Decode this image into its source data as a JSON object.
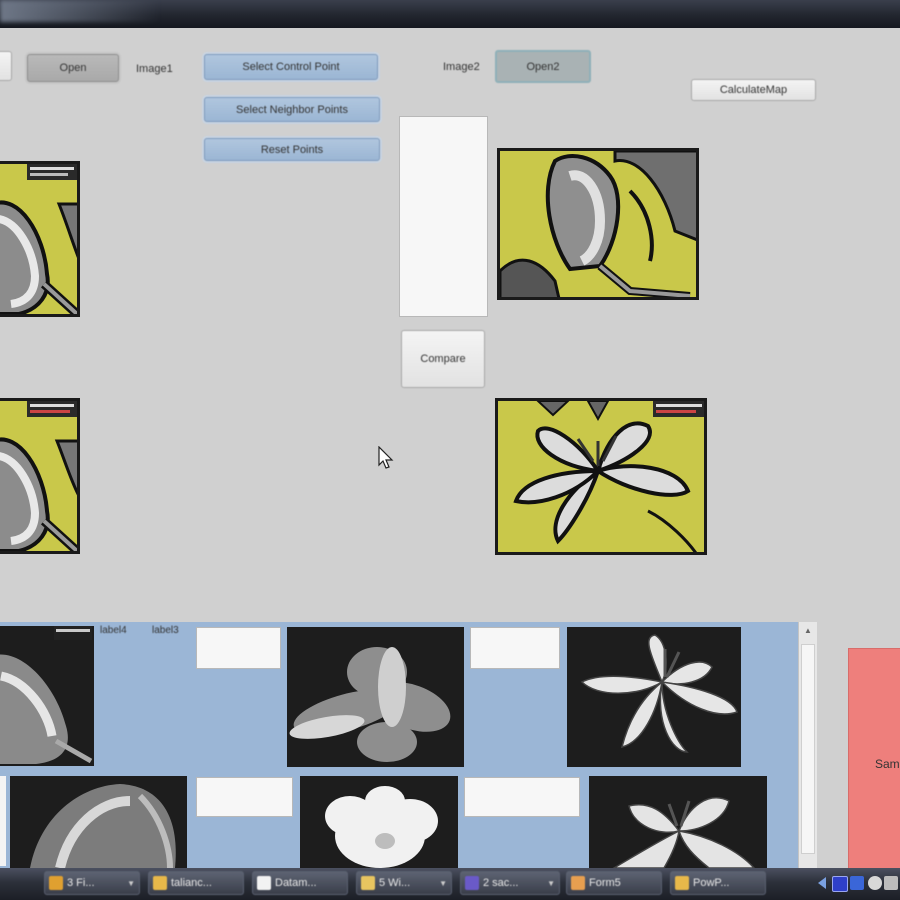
{
  "toolbar": {
    "open_label": "Open",
    "image1_label": "Image1",
    "select_control_label": "Select Control Point",
    "select_neighbor_label": "Select Neighbor Points",
    "reset_points_label": "Reset Points",
    "image2_label": "Image2",
    "open2_label": "Open2",
    "calculate_map_label": "CalculateMap"
  },
  "middle": {
    "compare_label": "Compare"
  },
  "gallery": {
    "label_a": "label4",
    "label_b": "label3"
  },
  "side_panel": {
    "label": "Sam"
  },
  "taskbar": {
    "items": [
      {
        "label": "3 Fi...",
        "icon": "folder-icon",
        "color": "#e0a030"
      },
      {
        "label": "talianc...",
        "icon": "folder-icon",
        "color": "#e7b84a"
      },
      {
        "label": "Datam...",
        "icon": "document-icon",
        "color": "#f2f2f2"
      },
      {
        "label": "5 Wi...",
        "icon": "window-icon",
        "color": "#e8c560"
      },
      {
        "label": "2 sac...",
        "icon": "visual-studio-icon",
        "color": "#6a5ac8"
      },
      {
        "label": "Form5",
        "icon": "form-icon",
        "color": "#e79f50"
      },
      {
        "label": "PowP...",
        "icon": "folder-icon",
        "color": "#e7b84a"
      }
    ]
  },
  "colors": {
    "accent_yellow": "#c9c84a",
    "gallery_blue": "#9bb6d6",
    "side_panel_red": "#ee7f7c"
  }
}
